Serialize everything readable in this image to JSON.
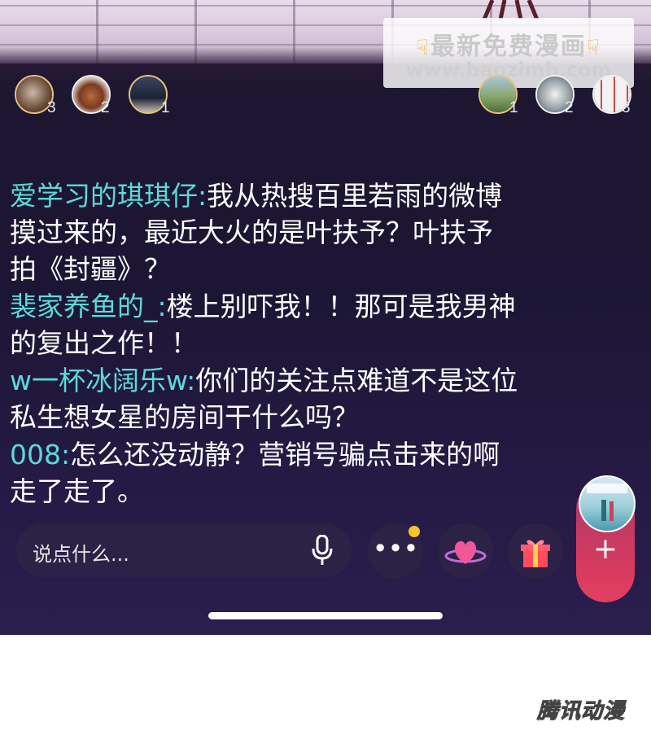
{
  "watermark": {
    "line1": "最新免费漫画",
    "line2": "www.baozimh.com"
  },
  "left_ranks": [
    "3",
    "2",
    "1"
  ],
  "right_ranks": [
    "1",
    "2",
    "3"
  ],
  "messages": [
    {
      "name": "爱学习的琪琪仔:",
      "text_lines": [
        "我从热搜百里若雨的微博",
        "摸过来的，最近大火的是叶扶予？叶扶予",
        "拍《封疆》？"
      ]
    },
    {
      "name": "裴家养鱼的_:",
      "text_lines": [
        "楼上别吓我！！那可是我男神",
        "的复出之作！！"
      ]
    },
    {
      "name": "w一杯冰阔乐w:",
      "text_lines": [
        "你们的关注点难道不是这位",
        "私生想女星的房间干什么吗？"
      ]
    },
    {
      "name": "008:",
      "text_lines": [
        "怎么还没动静？营销号骗点击来的啊",
        "走了走了。"
      ]
    }
  ],
  "input": {
    "placeholder": "说点什么..."
  },
  "buttons": {
    "more_label": "•••",
    "plus_label": "+"
  },
  "brand": "腾讯动漫"
}
